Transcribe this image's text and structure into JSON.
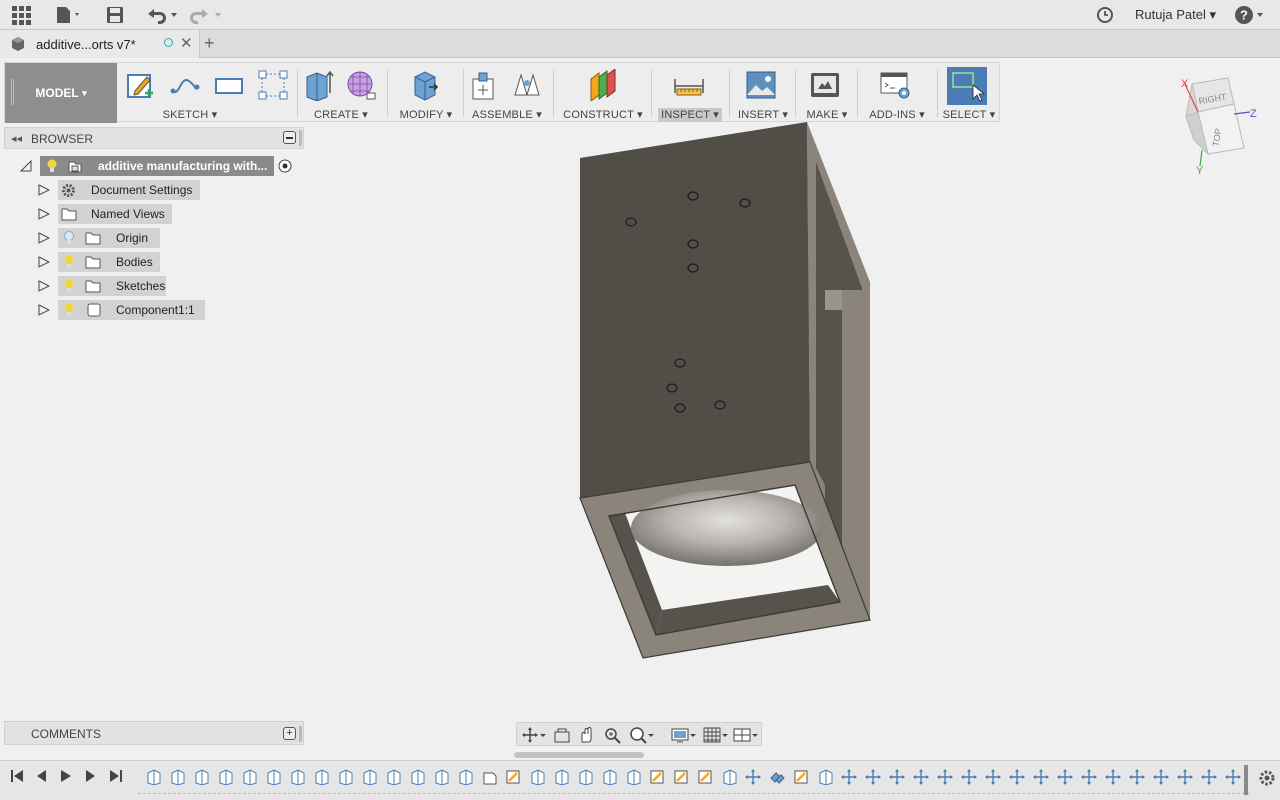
{
  "topbar": {
    "user_name": "Rutuja Patel",
    "user_caret": "▾",
    "help_caret": "▾"
  },
  "tab": {
    "title": "additive...orts v7*",
    "close": "✕",
    "new_tab": "+"
  },
  "toolbar": {
    "workspace": "MODEL",
    "workspace_caret": "▾",
    "groups": [
      {
        "label": "SKETCH ▾"
      },
      {
        "label": "CREATE ▾"
      },
      {
        "label": "MODIFY ▾"
      },
      {
        "label": "ASSEMBLE ▾"
      },
      {
        "label": "CONSTRUCT ▾"
      },
      {
        "label": "INSPECT ▾"
      },
      {
        "label": "INSERT ▾"
      },
      {
        "label": "MAKE ▾"
      },
      {
        "label": "ADD-INS ▾"
      },
      {
        "label": "SELECT ▾"
      }
    ]
  },
  "browser": {
    "title": "BROWSER",
    "collapse": "◂◂",
    "root": "additive manufacturing with...",
    "items": [
      {
        "label": "Document Settings"
      },
      {
        "label": "Named Views"
      },
      {
        "label": "Origin"
      },
      {
        "label": "Bodies"
      },
      {
        "label": "Sketches"
      },
      {
        "label": "Component1:1"
      }
    ]
  },
  "comments": {
    "title": "COMMENTS",
    "add": "+"
  },
  "viewcube": {
    "face_right": "RIGHT",
    "face_top": "TOP",
    "axis_x": "X",
    "axis_y": "Y",
    "axis_z": "Z"
  },
  "colors": {
    "accent": "#4a7db5",
    "model_body": "#514d47",
    "model_frame": "#8b847a",
    "workspace_btn": "#8e8e8e"
  }
}
